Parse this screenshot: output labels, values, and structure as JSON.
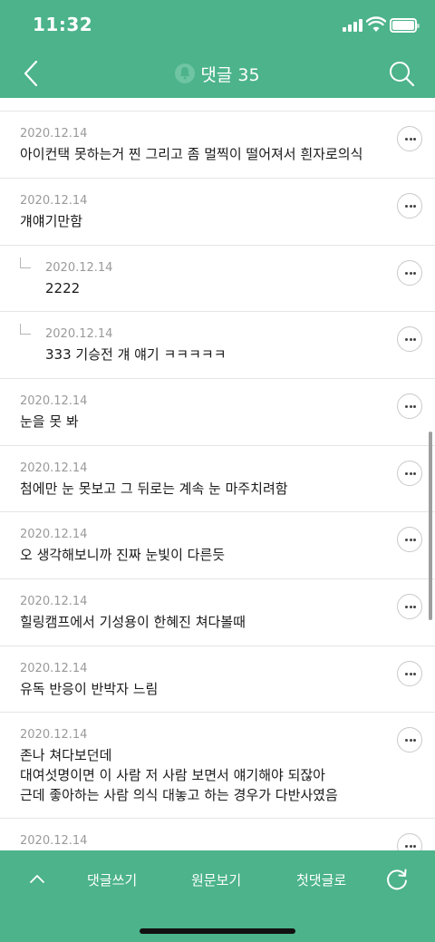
{
  "status_bar": {
    "time": "11:32"
  },
  "header": {
    "title": "댓글 35"
  },
  "comments": [
    {
      "date": "2020.12.14",
      "text": "아이컨택 못하는거 찐 그리고 좀 멀찍이 떨어져서 흰자로의식",
      "reply": false
    },
    {
      "date": "2020.12.14",
      "text": "걔얘기만함",
      "reply": false
    },
    {
      "date": "2020.12.14",
      "text": "2222",
      "reply": true
    },
    {
      "date": "2020.12.14",
      "text": "333 기승전 걔 얘기 ㅋㅋㅋㅋㅋ",
      "reply": true
    },
    {
      "date": "2020.12.14",
      "text": "눈을 못 봐",
      "reply": false
    },
    {
      "date": "2020.12.14",
      "text": "첨에만 눈 못보고 그 뒤로는 계속 눈 마주치려함",
      "reply": false
    },
    {
      "date": "2020.12.14",
      "text": "오 생각해보니까 진짜 눈빛이 다른듯",
      "reply": false
    },
    {
      "date": "2020.12.14",
      "text": "힐링캠프에서 기성용이 한혜진 쳐다볼때",
      "reply": false
    },
    {
      "date": "2020.12.14",
      "text": "유독 반응이 반박자 느림",
      "reply": false
    },
    {
      "date": "2020.12.14",
      "lines": [
        "존나 쳐다보던데",
        "대여섯명이면 이 사람 저 사람 보면서 얘기해야 되잖아",
        "근데 좋아하는 사람 의식 대놓고 하는 경우가 다반사였음"
      ],
      "reply": false
    },
    {
      "date": "2020.12.14",
      "text": "",
      "reply": false
    }
  ],
  "bottom_bar": {
    "write_label": "댓글쓰기",
    "original_label": "원문보기",
    "first_label": "첫댓글로"
  },
  "colors": {
    "brand": "#4cb38b",
    "divider": "#e5e5e5",
    "date": "#9a9a9a"
  },
  "icons": [
    "back-arrow-icon",
    "bell-icon",
    "search-icon",
    "more-icon",
    "reply-indent-icon",
    "chevron-up-icon",
    "refresh-icon"
  ]
}
